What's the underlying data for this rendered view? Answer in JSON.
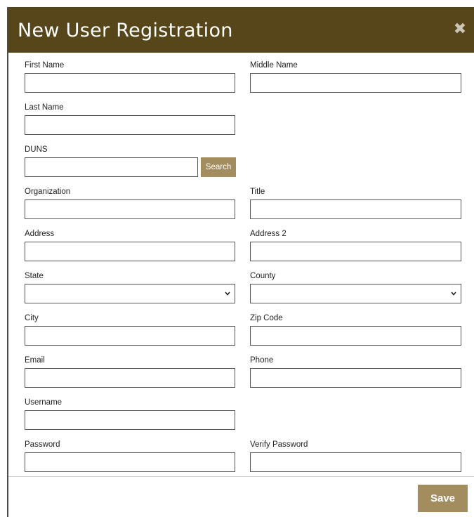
{
  "modal": {
    "title": "New User Registration",
    "close_glyph": "✖"
  },
  "fields": {
    "first_name": {
      "label": "First Name",
      "value": ""
    },
    "middle_name": {
      "label": "Middle Name",
      "value": ""
    },
    "last_name": {
      "label": "Last Name",
      "value": ""
    },
    "duns": {
      "label": "DUNS",
      "value": "",
      "button_label": "Search"
    },
    "organization": {
      "label": "Organization",
      "value": ""
    },
    "title": {
      "label": "Title",
      "value": ""
    },
    "address": {
      "label": "Address",
      "value": ""
    },
    "address2": {
      "label": "Address 2",
      "value": ""
    },
    "state": {
      "label": "State",
      "selected": ""
    },
    "county": {
      "label": "County",
      "selected": ""
    },
    "city": {
      "label": "City",
      "value": ""
    },
    "zip": {
      "label": "Zip Code",
      "value": ""
    },
    "email": {
      "label": "Email",
      "value": ""
    },
    "phone": {
      "label": "Phone",
      "value": ""
    },
    "username": {
      "label": "Username",
      "value": ""
    },
    "password": {
      "label": "Password",
      "value": ""
    },
    "verify_password": {
      "label": "Verify Password",
      "value": ""
    }
  },
  "footer": {
    "save_label": "Save"
  },
  "colors": {
    "header_bg": "#56461a",
    "button_bg": "#a38c5e",
    "header_text": "#ffffff"
  },
  "icons": {
    "close": "close-icon",
    "select_chevron": "chevron-down-icon"
  }
}
